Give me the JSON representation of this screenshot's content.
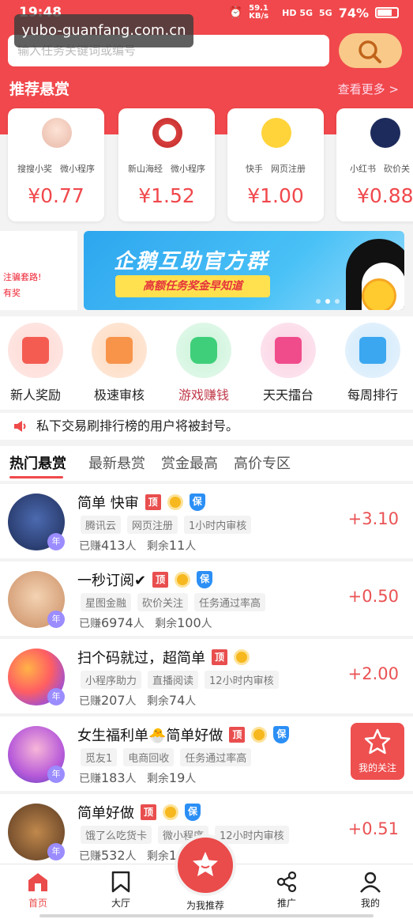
{
  "status_bar": {
    "time": "19:48",
    "net_speed": "59.1 KB/s",
    "signal_1": "HD 5G",
    "signal_2": "5G",
    "battery": "74%"
  },
  "watermark": "yubo-guanfang.com.cn",
  "search": {
    "placeholder": "输入任务关键词或编号"
  },
  "recommended": {
    "title": "推荐悬赏",
    "more": "查看更多 >",
    "cards": [
      {
        "tags": [
          "搜搜小奖",
          "微小程序"
        ],
        "price": "¥0.77"
      },
      {
        "tags": [
          "新山海经",
          "微小程序"
        ],
        "price": "¥1.52"
      },
      {
        "tags": [
          "快手",
          "网页注册"
        ],
        "price": "¥1.00"
      },
      {
        "tags": [
          "小红书",
          "砍价关"
        ],
        "price": "¥0.88"
      }
    ]
  },
  "banner": {
    "left_text_1": "注骗套路!",
    "left_text_2": "有奖",
    "title": "企鹅互助官方群",
    "subtitle": "高额任务奖金早知道"
  },
  "quick_entries": [
    {
      "label": "新人奖励",
      "color": "#f45c52",
      "icon": "gift-icon"
    },
    {
      "label": "极速审核",
      "color": "#f7944a",
      "icon": "document-icon"
    },
    {
      "label": "游戏赚钱",
      "color": "#3fcf7a",
      "icon": "gamepad-icon"
    },
    {
      "label": "天天擂台",
      "color": "#f04c8c",
      "icon": "flag-icon"
    },
    {
      "label": "每周排行",
      "color": "#3ba7f0",
      "icon": "bar-chart-icon"
    }
  ],
  "notice": "私下交易刷排行榜的用户将被封号。",
  "tabs": [
    "热门悬赏",
    "最新悬赏",
    "赏金最高",
    "高价专区"
  ],
  "tasks": [
    {
      "title": "简单 快审",
      "badges": [
        "顶",
        "gold",
        "保"
      ],
      "tags": [
        "腾讯云",
        "网页注册",
        "1小时内审核"
      ],
      "earned_prefix": "已赚",
      "earned": "413",
      "earned_unit": "人",
      "remaining_prefix": "剩余",
      "remaining": "11",
      "remaining_unit": "人",
      "price": "+3.10"
    },
    {
      "title": "一秒订阅✔",
      "badges": [
        "顶",
        "gold",
        "保"
      ],
      "tags": [
        "星图金融",
        "砍价关注",
        "任务通过率高"
      ],
      "earned_prefix": "已赚",
      "earned": "6974",
      "earned_unit": "人",
      "remaining_prefix": "剩余",
      "remaining": "100",
      "remaining_unit": "人",
      "price": "+0.50"
    },
    {
      "title": "扫个码就过，超简单",
      "badges": [
        "顶",
        "gold"
      ],
      "tags": [
        "小程序助力",
        "直播阅读",
        "12小时内审核"
      ],
      "earned_prefix": "已赚",
      "earned": "207",
      "earned_unit": "人",
      "remaining_prefix": "剩余",
      "remaining": "74",
      "remaining_unit": "人",
      "price": "+2.00"
    },
    {
      "title": "女生福利单🐣简单好做",
      "badges": [
        "顶",
        "gold",
        "保"
      ],
      "tags": [
        "觅友1",
        "电商回收",
        "任务通过率高"
      ],
      "earned_prefix": "已赚",
      "earned": "183",
      "earned_unit": "人",
      "remaining_prefix": "剩余",
      "remaining": "19",
      "remaining_unit": "人",
      "price": ""
    },
    {
      "title": "简单好做",
      "badges": [
        "顶",
        "gold",
        "保"
      ],
      "tags": [
        "饿了么吃货卡",
        "微小程序",
        "12小时内审核"
      ],
      "earned_prefix": "已赚",
      "earned": "532",
      "earned_unit": "人",
      "remaining_prefix": "剩余",
      "remaining": "16",
      "remaining_unit": "",
      "price": "+0.51"
    }
  ],
  "year_badge": "年",
  "follow_button": "我的关注",
  "bottom_nav": {
    "home": "首页",
    "hall": "大厅",
    "center": "为我推荐",
    "promote": "推广",
    "mine": "我的"
  },
  "colors": {
    "brand_red": "#f0484c",
    "price_red": "#ea5254",
    "search_button": "#f9c98a"
  }
}
